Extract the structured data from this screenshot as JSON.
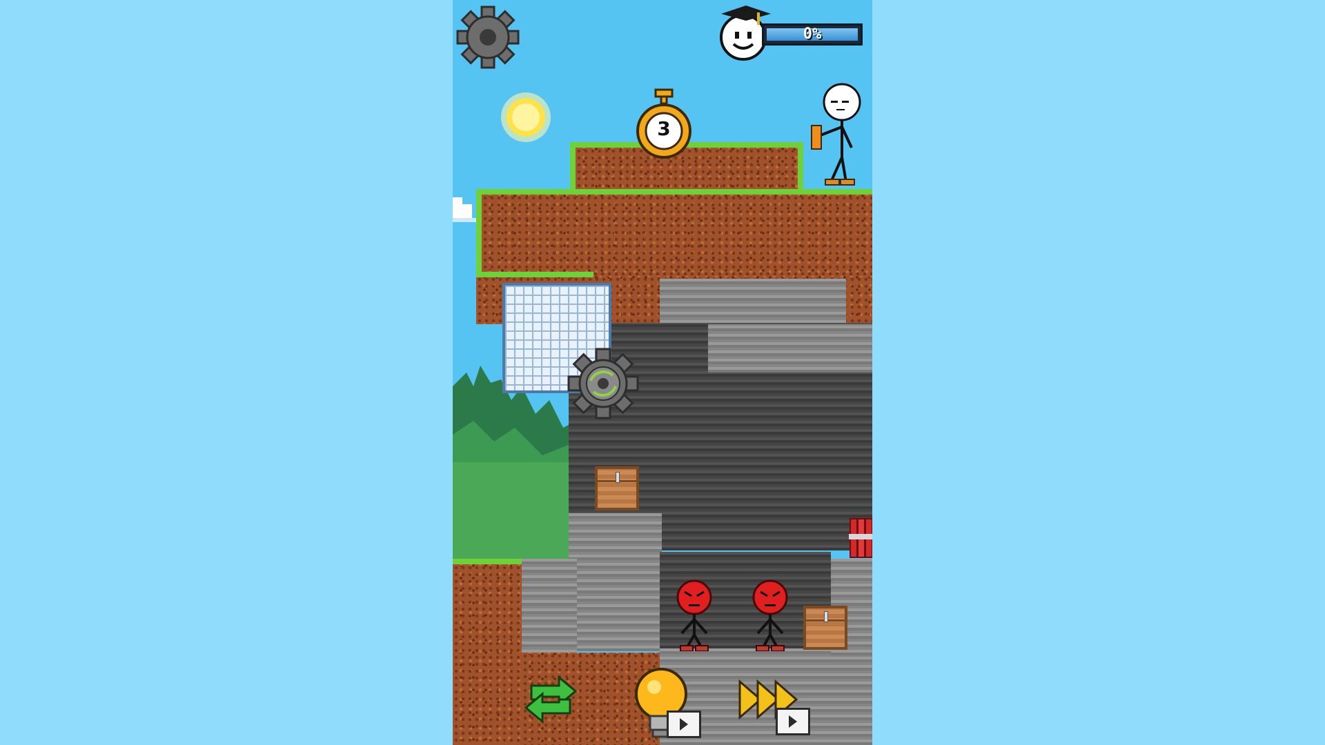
{
  "hud": {
    "settings_icon": "gear-icon",
    "progress_percent": 0,
    "progress_label": "0%",
    "progress_icon": "graduate-smiley-face"
  },
  "level": {
    "timer_value": "3",
    "timer_icon": "stopwatch-icon"
  },
  "characters": {
    "player": "stickman-with-pencil",
    "enemies": [
      "angry-red-stickman",
      "angry-red-stickman"
    ]
  },
  "controls": {
    "restart_icon": "restart-arrows-icon",
    "hint_icon": "lightbulb-icon",
    "skip_icon": "fast-forward-icon",
    "ad_badge_icon": "video-ad-icon"
  },
  "colors": {
    "sky": "#56c4f2",
    "outer_background": "#8fdcfc",
    "grass": "#6ed13a",
    "dirt": "#a0522d",
    "enemy_red": "#e02020",
    "restart_green": "#3fbf3f",
    "skip_yellow": "#f2c21a"
  }
}
